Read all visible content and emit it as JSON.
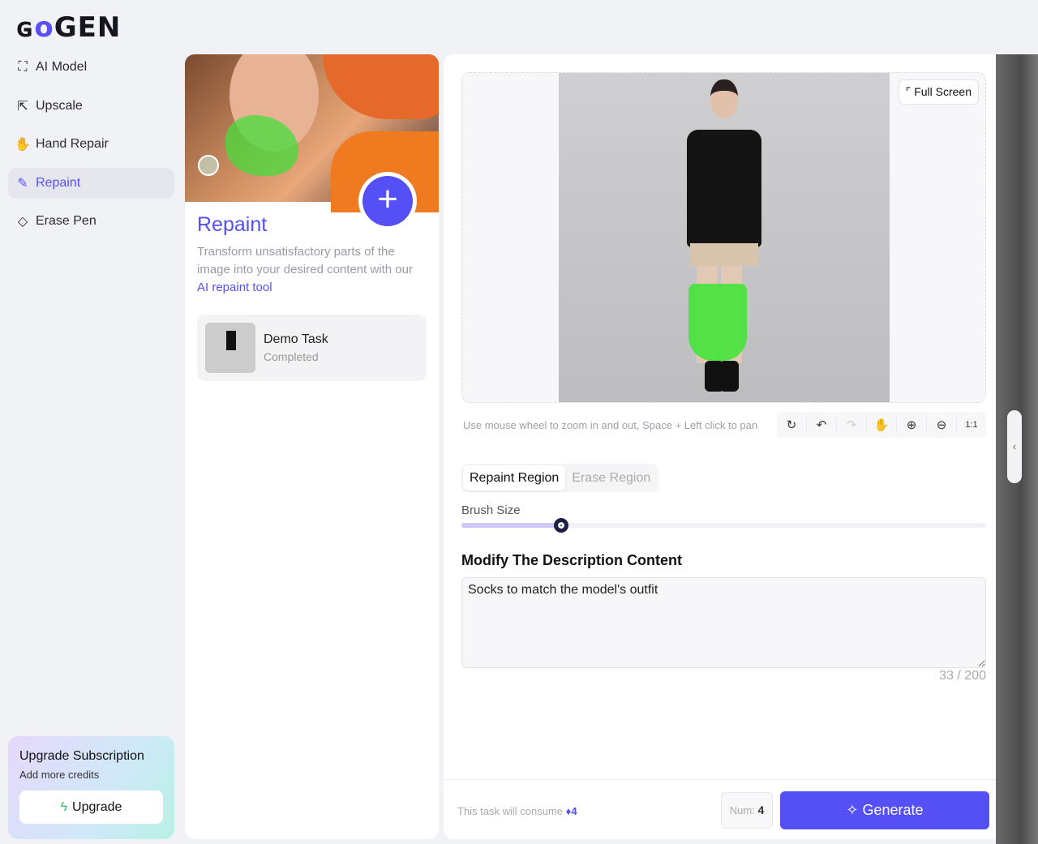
{
  "brand": {
    "logo": "GOGEN",
    "accent": "#5450f5"
  },
  "sidebar": {
    "items": [
      {
        "label": "AI Model",
        "icon": "ai-model-icon"
      },
      {
        "label": "Upscale",
        "icon": "upscale-icon"
      },
      {
        "label": "Hand Repair",
        "icon": "hand-repair-icon"
      },
      {
        "label": "Repaint",
        "icon": "repaint-icon",
        "active": true
      },
      {
        "label": "Erase Pen",
        "icon": "eraser-icon"
      }
    ],
    "upgrade": {
      "title": "Upgrade Subscription",
      "subtitle": "Add more credits",
      "button": "Upgrade"
    }
  },
  "tool_card": {
    "title": "Repaint",
    "desc": "Transform unsatisfactory parts of the image into your desired content with our ",
    "link": "AI repaint tool",
    "task": {
      "name": "Demo Task",
      "status": "Completed"
    }
  },
  "editor": {
    "full_screen": "Full Screen",
    "hint": "Use mouse wheel to zoom in and out, Space + Left click to pan",
    "tools": [
      "reset",
      "undo",
      "redo",
      "pan",
      "zoom-in",
      "zoom-out",
      "1:1"
    ],
    "tabs": [
      "Repaint Region",
      "Erase Region"
    ],
    "brush_label": "Brush Size",
    "brush_value_pct": 19,
    "desc_heading": "Modify The Description Content",
    "desc_value": "Socks to match the model's outfit",
    "char_count": "33 / 200",
    "consume_label": "This task will consume",
    "consume_value": "4",
    "num_label": "Num:",
    "num_value": "4",
    "generate": "Generate"
  }
}
